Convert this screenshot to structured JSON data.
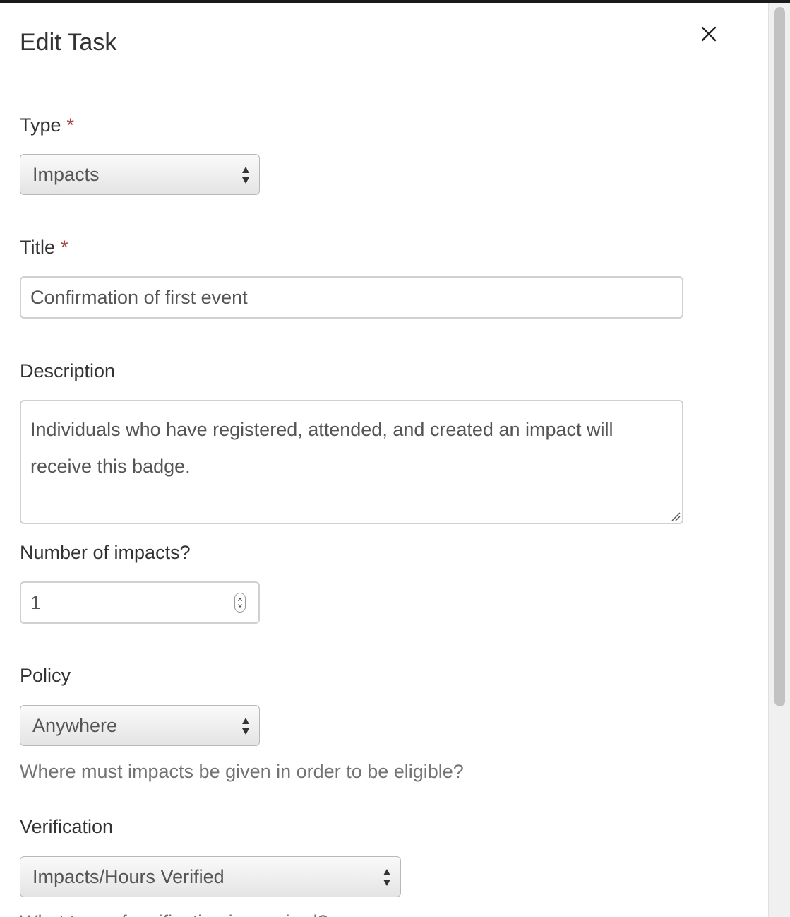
{
  "modal": {
    "title": "Edit Task",
    "close_icon": "close-icon"
  },
  "form": {
    "type": {
      "label": "Type",
      "required_mark": "*",
      "value": "Impacts"
    },
    "title": {
      "label": "Title",
      "required_mark": "*",
      "value": "Confirmation of first event"
    },
    "description": {
      "label": "Description",
      "value": "Individuals who have registered, attended, and created an impact will receive this badge."
    },
    "number_of_impacts": {
      "label": "Number of impacts?",
      "value": "1"
    },
    "policy": {
      "label": "Policy",
      "value": "Anywhere",
      "help": "Where must impacts be given in order to be eligible?"
    },
    "verification": {
      "label": "Verification",
      "value": "Impacts/Hours Verified",
      "help": "What type of verification is required?"
    }
  },
  "colors": {
    "required": "#a94442",
    "label": "#333333",
    "help": "#737373",
    "border": "#d0d0d0"
  }
}
